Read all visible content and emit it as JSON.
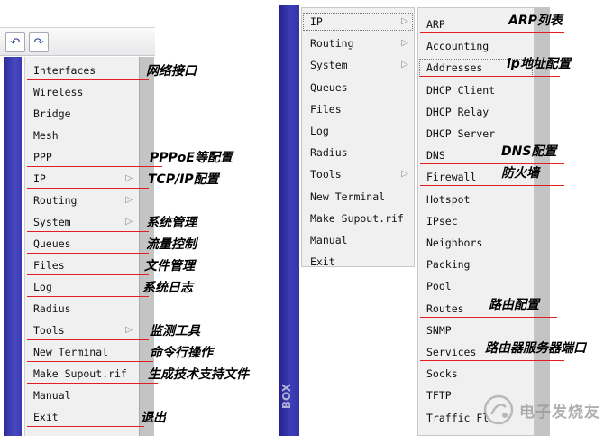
{
  "toolbar": {
    "undo_icon": "undo-icon",
    "redo_icon": "redo-icon"
  },
  "left_menu": {
    "items": [
      {
        "label": "Interfaces",
        "has_submenu": false
      },
      {
        "label": "Wireless",
        "has_submenu": false
      },
      {
        "label": "Bridge",
        "has_submenu": false
      },
      {
        "label": "Mesh",
        "has_submenu": false
      },
      {
        "label": "PPP",
        "has_submenu": false
      },
      {
        "label": "IP",
        "has_submenu": true
      },
      {
        "label": "Routing",
        "has_submenu": true
      },
      {
        "label": "System",
        "has_submenu": true
      },
      {
        "label": "Queues",
        "has_submenu": false
      },
      {
        "label": "Files",
        "has_submenu": false
      },
      {
        "label": "Log",
        "has_submenu": false
      },
      {
        "label": "Radius",
        "has_submenu": false
      },
      {
        "label": "Tools",
        "has_submenu": true
      },
      {
        "label": "New Terminal",
        "has_submenu": false
      },
      {
        "label": "Make Supout.rif",
        "has_submenu": false
      },
      {
        "label": "Manual",
        "has_submenu": false
      },
      {
        "label": "Exit",
        "has_submenu": false
      }
    ]
  },
  "left_annotations": [
    "网络接口",
    "PPPoE等配置",
    "TCP/IP配置",
    "系统管理",
    "流量控制",
    "文件管理",
    "系统日志",
    "监测工具",
    "命令行操作",
    "生成技术支持文件",
    "退出"
  ],
  "right_menu": {
    "items": [
      {
        "label": "IP",
        "has_submenu": true
      },
      {
        "label": "Routing",
        "has_submenu": true
      },
      {
        "label": "System",
        "has_submenu": true
      },
      {
        "label": "Queues",
        "has_submenu": false
      },
      {
        "label": "Files",
        "has_submenu": false
      },
      {
        "label": "Log",
        "has_submenu": false
      },
      {
        "label": "Radius",
        "has_submenu": false
      },
      {
        "label": "Tools",
        "has_submenu": true
      },
      {
        "label": "New Terminal",
        "has_submenu": false
      },
      {
        "label": "Make Supout.rif",
        "has_submenu": false
      },
      {
        "label": "Manual",
        "has_submenu": false
      },
      {
        "label": "Exit",
        "has_submenu": false
      }
    ]
  },
  "ip_submenu": {
    "items": [
      {
        "label": "ARP"
      },
      {
        "label": "Accounting"
      },
      {
        "label": "Addresses"
      },
      {
        "label": "DHCP Client"
      },
      {
        "label": "DHCP Relay"
      },
      {
        "label": "DHCP Server"
      },
      {
        "label": "DNS"
      },
      {
        "label": "Firewall"
      },
      {
        "label": "Hotspot"
      },
      {
        "label": "IPsec"
      },
      {
        "label": "Neighbors"
      },
      {
        "label": "Packing"
      },
      {
        "label": "Pool"
      },
      {
        "label": "Routes"
      },
      {
        "label": "SNMP"
      },
      {
        "label": "Services"
      },
      {
        "label": "Socks"
      },
      {
        "label": "TFTP"
      },
      {
        "label": "Traffic Fl"
      }
    ]
  },
  "right_annotations": [
    "ARP列表",
    "ip地址配置",
    "DNS配置",
    "防火墙",
    "路由配置",
    "路由器服务器端口"
  ],
  "side_stripe_text": "BOX",
  "watermark": {
    "text": "电子发烧友"
  },
  "colors": {
    "stripe": "#3a3ab0",
    "underline": "#e02020",
    "menu_bg": "#f0f0f0"
  }
}
